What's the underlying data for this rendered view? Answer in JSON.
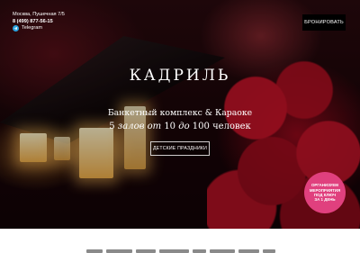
{
  "header": {
    "address": "Москва, Пушечная 7/5",
    "phone": "8 (499) 877-56-15",
    "telegram_label": "Telegram",
    "book_label": "БРОНИРОВАТЬ"
  },
  "hero": {
    "logo": "КАДРИЛЬ",
    "subtitle": "Банкетный комплекс & Караоке",
    "halls_count": "5",
    "halls_word": "залов",
    "from_word": "от",
    "from_value": "10",
    "to_word": "до",
    "to_value": "100",
    "people_word": "человек",
    "kids_button_label": "ДЕТСКИЕ ПРАЗДНИКИ"
  },
  "promo": {
    "line1": "ОРГАНИЗУЕМ",
    "line2": "МЕРОПРИЯТИЯ",
    "line3": "ПОД КЛЮЧ",
    "line4": "ЗА 1 ДЕНЬ",
    "color": "#e0407e"
  },
  "icons": {
    "telegram": "telegram-icon"
  },
  "colors": {
    "book_button_bg": "#000000",
    "hero_tint": "#1a0508",
    "accent_red": "#c8142a"
  }
}
